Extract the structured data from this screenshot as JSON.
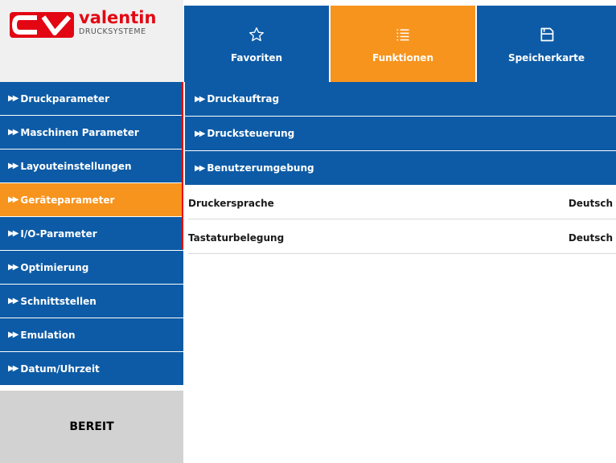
{
  "logo": {
    "name": "valentin",
    "subtitle": "DRUCKSYSTEME"
  },
  "topbar": [
    {
      "label": "Favoriten",
      "icon": "star-icon"
    },
    {
      "label": "Funktionen",
      "icon": "list-icon",
      "active": true
    },
    {
      "label": "Speicherkarte",
      "icon": "save-icon"
    }
  ],
  "left_menu": [
    {
      "label": "Druckparameter"
    },
    {
      "label": "Maschinen Parameter"
    },
    {
      "label": "Layouteinstellungen"
    },
    {
      "label": "Geräteparameter",
      "active": true
    },
    {
      "label": "I/O-Parameter"
    },
    {
      "label": "Optimierung"
    },
    {
      "label": "Schnittstellen"
    },
    {
      "label": "Emulation"
    },
    {
      "label": "Datum/Uhrzeit"
    }
  ],
  "right_menu": [
    {
      "label": "Druckauftrag"
    },
    {
      "label": "Drucksteuerung"
    },
    {
      "label": "Benutzerumgebung"
    }
  ],
  "params": [
    {
      "label": "Druckersprache",
      "value": "Deutsch"
    },
    {
      "label": "Tastaturbelegung",
      "value": "Deutsch"
    }
  ],
  "status": "BEREIT",
  "colors": {
    "blue": "#0d5ba6",
    "orange": "#f7941d",
    "red": "#e30613",
    "status_bg": "#d2d2d2"
  }
}
